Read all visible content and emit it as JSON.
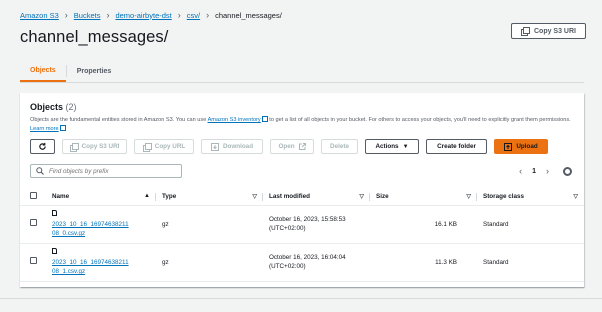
{
  "breadcrumb": {
    "items": [
      "Amazon S3",
      "Buckets",
      "demo-airbyte-dst",
      "csv/"
    ],
    "current": "channel_messages/"
  },
  "page": {
    "title": "channel_messages/",
    "copy_s3_uri_label": "Copy S3 URI"
  },
  "tabs": [
    {
      "label": "Objects",
      "active": true
    },
    {
      "label": "Properties",
      "active": false
    }
  ],
  "objects_panel": {
    "title": "Objects",
    "count": "(2)",
    "description": {
      "before_link": "Objects are the fundamental entities stored in Amazon S3. You can use ",
      "link": "Amazon S3 inventory",
      "after_link": " to get a list of all objects in your bucket. For others to access your objects, you'll need to explicitly grant them permissions. ",
      "learn_more": "Learn more"
    },
    "toolbar": {
      "refresh": "refresh",
      "copy_s3_uri": "Copy S3 URI",
      "copy_url": "Copy URL",
      "download": "Download",
      "open": "Open",
      "delete": "Delete",
      "actions": "Actions",
      "create_folder": "Create folder",
      "upload": "Upload"
    },
    "search_placeholder": "Find objects by prefix",
    "pagination": {
      "current_page": "1"
    },
    "columns": [
      "Name",
      "Type",
      "Last modified",
      "Size",
      "Storage class"
    ],
    "rows": [
      {
        "name_line1": "2023_10_16_16974638211",
        "name_line2": "08_0.csv.gz",
        "type": "gz",
        "modified_line1": "October 16, 2023, 15:58:53",
        "modified_line2": "(UTC+02:00)",
        "size": "16.1 KB",
        "storage_class": "Standard"
      },
      {
        "name_line1": "2023_10_16_16974638211",
        "name_line2": "08_1.csv.gz",
        "type": "gz",
        "modified_line1": "October 16, 2023, 16:04:04",
        "modified_line2": "(UTC+02:00)",
        "size": "11.3 KB",
        "storage_class": "Standard"
      }
    ]
  },
  "colors": {
    "accent": "#ec7211",
    "link": "#0073bb",
    "background": "#f2f3f3"
  }
}
